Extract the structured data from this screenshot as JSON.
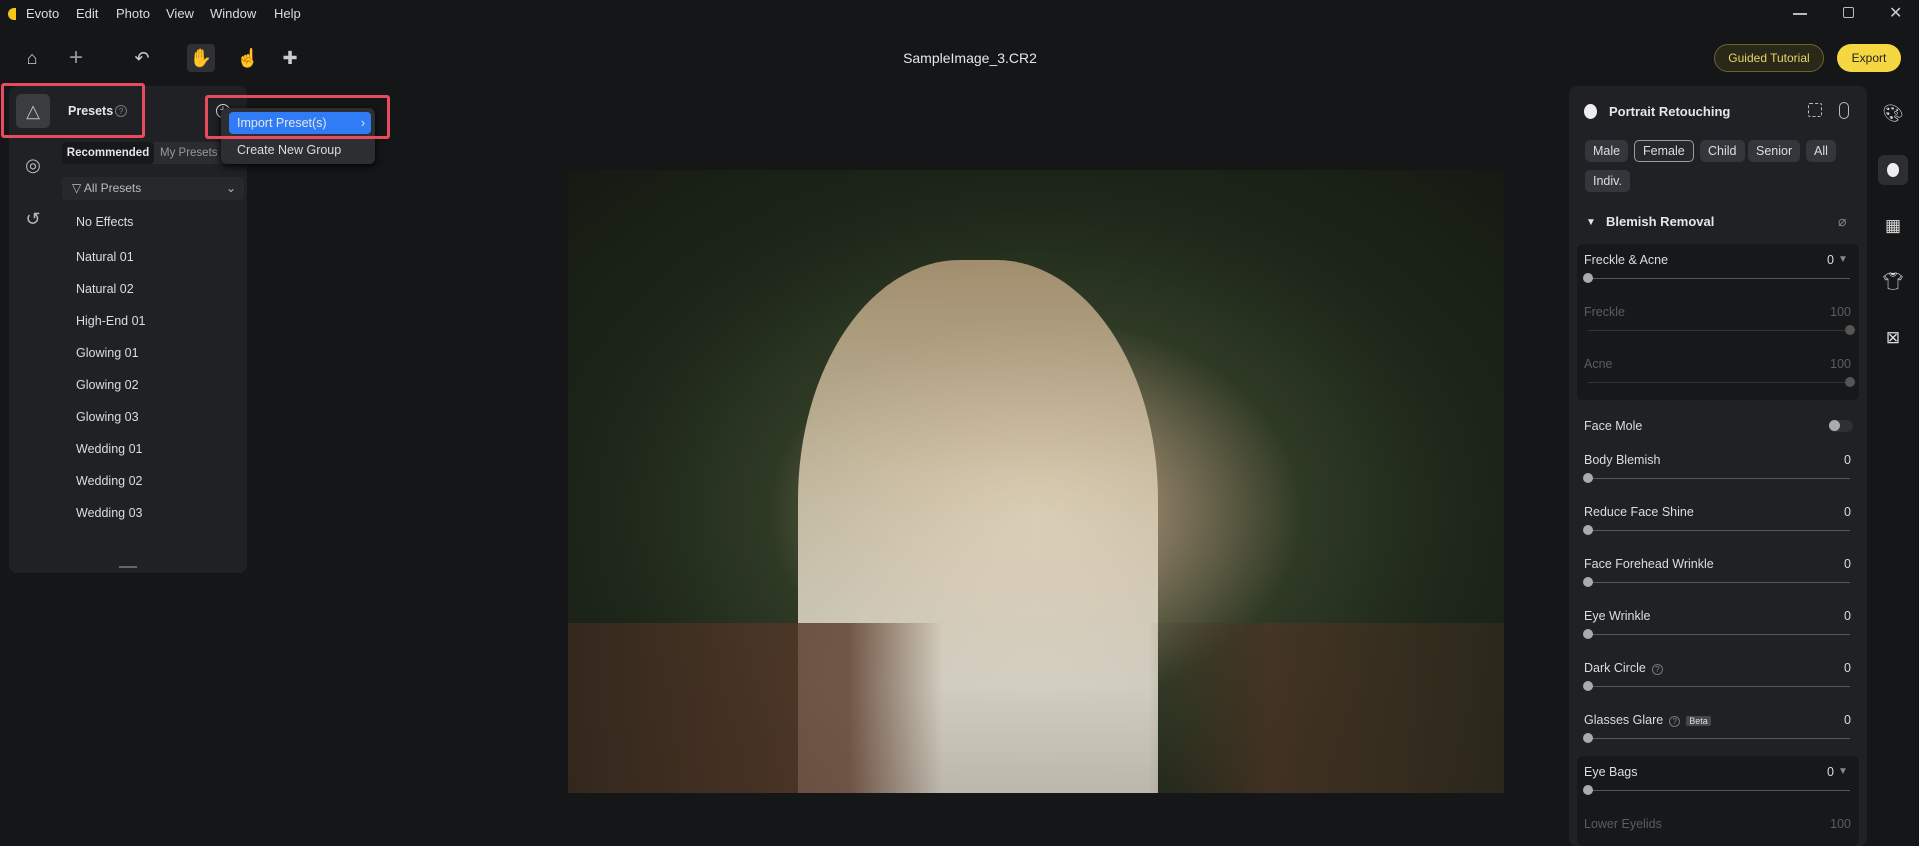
{
  "menu": {
    "app": "Evoto",
    "items": [
      "Edit",
      "Photo",
      "View",
      "Window",
      "Help"
    ]
  },
  "title": "SampleImage_3.CR2",
  "toolbar": {
    "tutorial": "Guided Tutorial",
    "export": "Export",
    "accent": "#f5d742"
  },
  "presets": {
    "title": "Presets",
    "tabs": [
      "Recommended",
      "My Presets"
    ],
    "filter": "All Presets",
    "items": [
      "No Effects",
      "Natural 01",
      "Natural 02",
      "High-End 01",
      "Glowing 01",
      "Glowing 02",
      "Glowing 03",
      "Wedding 01",
      "Wedding 02",
      "Wedding 03"
    ]
  },
  "popup": {
    "items": [
      "Import Preset(s)",
      "Create New Group"
    ],
    "highlight": "#2f7cf6"
  },
  "portrait": {
    "title": "Portrait Retouching",
    "chips": [
      "Male",
      "Female",
      "Child",
      "Senior",
      "All",
      "Indiv."
    ],
    "selected_chip": "Female",
    "section": "Blemish Removal",
    "freckle": {
      "label": "Freckle & Acne",
      "value": "0",
      "sub": [
        {
          "label": "Freckle",
          "value": "100"
        },
        {
          "label": "Acne",
          "value": "100"
        }
      ]
    },
    "face_mole": {
      "label": "Face Mole",
      "on": false
    },
    "sliders": [
      {
        "label": "Body Blemish",
        "value": "0"
      },
      {
        "label": "Reduce Face Shine",
        "value": "0"
      },
      {
        "label": "Face Forehead Wrinkle",
        "value": "0"
      },
      {
        "label": "Eye Wrinkle",
        "value": "0"
      },
      {
        "label": "Dark Circle",
        "value": "0"
      },
      {
        "label": "Glasses Glare",
        "value": "0",
        "badge": "Beta"
      }
    ],
    "eye_bags": {
      "label": "Eye Bags",
      "value": "0",
      "sub": {
        "label": "Lower Eyelids",
        "value": "100"
      }
    }
  }
}
